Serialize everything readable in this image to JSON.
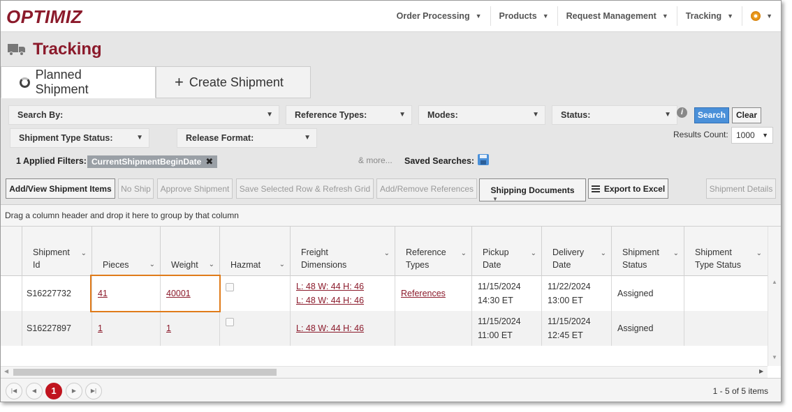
{
  "app": {
    "logo": "OPTIMIZ"
  },
  "nav": {
    "items": [
      {
        "label": "Order Processing"
      },
      {
        "label": "Products"
      },
      {
        "label": "Request Management"
      },
      {
        "label": "Tracking"
      }
    ]
  },
  "page": {
    "title": "Tracking"
  },
  "tabs": [
    {
      "label": "Planned Shipment",
      "active": true
    },
    {
      "label": "Create Shipment",
      "active": false
    }
  ],
  "filters": {
    "search_by": "Search By:",
    "reference_types": "Reference Types:",
    "modes": "Modes:",
    "status": "Status:",
    "shipment_type_status": "Shipment Type Status:",
    "release_format": "Release Format:",
    "search_button": "Search",
    "clear_button": "Clear",
    "results_count_label": "Results Count:",
    "results_count_value": "1000",
    "applied_label": "1 Applied Filters:",
    "applied_chip": "CurrentShipmentBeginDate",
    "more": "& more...",
    "saved_searches": "Saved Searches:"
  },
  "toolbar": {
    "add_view": "Add/View Shipment Items",
    "no_ship": "No Ship",
    "approve": "Approve Shipment",
    "save_refresh": "Save Selected Row & Refresh Grid",
    "add_remove_refs": "Add/Remove References",
    "shipping_docs": "Shipping Documents",
    "export_excel": "Export to Excel",
    "shipment_details": "Shipment Details"
  },
  "grid": {
    "group_hint": "Drag a column header and drop it here to group by that column",
    "headers": {
      "shipment_id_1": "Shipment",
      "shipment_id_2": "Id",
      "pieces": "Pieces",
      "weight": "Weight",
      "hazmat": "Hazmat",
      "freight_1": "Freight",
      "freight_2": "Dimensions",
      "reftypes_1": "Reference",
      "reftypes_2": "Types",
      "pickup_1": "Pickup",
      "pickup_2": "Date",
      "delivery_1": "Delivery",
      "delivery_2": "Date",
      "status_1": "Shipment",
      "status_2": "Status",
      "typestatus_1": "Shipment",
      "typestatus_2": "Type Status"
    },
    "rows": [
      {
        "id": "S16227732",
        "pieces": "41",
        "weight": "40001",
        "freight_1": "L: 48 W: 44 H: 46",
        "freight_2": "L: 48 W: 44 H: 46",
        "references": "References",
        "pickup_date": "11/15/2024",
        "pickup_time": "14:30 ET",
        "delivery_date": "11/22/2024",
        "delivery_time": "13:00 ET",
        "status": "Assigned"
      },
      {
        "id": "S16227897",
        "pieces": "1",
        "weight": "1",
        "freight_1": "L: 48 W: 44 H: 46",
        "pickup_date": "11/15/2024",
        "pickup_time": "11:00 ET",
        "delivery_date": "11/15/2024",
        "delivery_time": "12:45 ET",
        "status": "Assigned"
      }
    ],
    "pager": {
      "current_page": "1",
      "info": "1 - 5 of 5 items"
    }
  }
}
